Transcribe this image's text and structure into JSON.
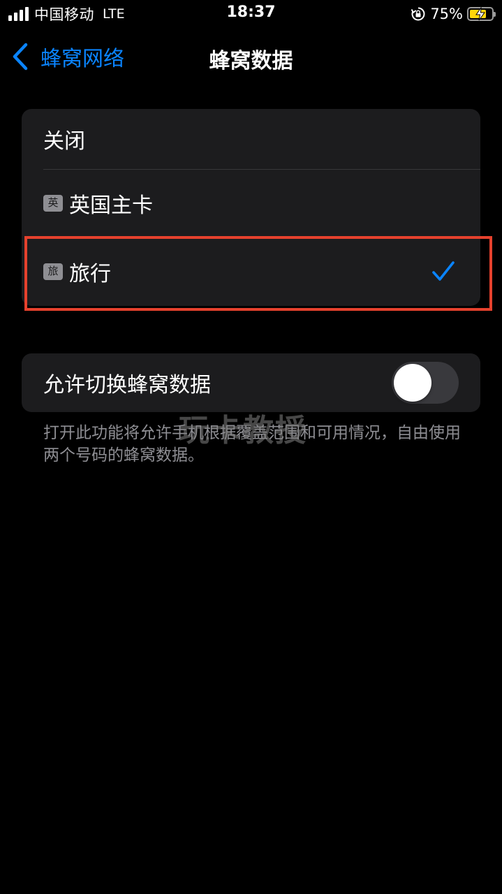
{
  "status_bar": {
    "carrier": "中国移动",
    "network": "LTE",
    "time": "18:37",
    "battery_percent": "75%",
    "battery_level": 0.75,
    "battery_color": "#ffd60a",
    "icons": [
      "signal-icon",
      "rotation-lock-icon",
      "battery-charging-icon"
    ]
  },
  "nav": {
    "back_label": "蜂窝网络",
    "title": "蜂窝数据"
  },
  "line_options": {
    "items": [
      {
        "label": "关闭",
        "badge": "",
        "selected": false
      },
      {
        "label": "英国主卡",
        "badge": "英",
        "selected": false
      },
      {
        "label": "旅行",
        "badge": "旅",
        "selected": true
      }
    ],
    "check_icon": "checkmark-icon",
    "accent_color": "#0a84ff",
    "highlight_color": "#e5412d"
  },
  "switch_section": {
    "label": "允许切换蜂窝数据",
    "enabled": false,
    "footer": "打开此功能将允许手机根据覆盖范围和可用情况，自由使用两个号码的蜂窝数据。"
  },
  "watermark": "玩卡教授"
}
